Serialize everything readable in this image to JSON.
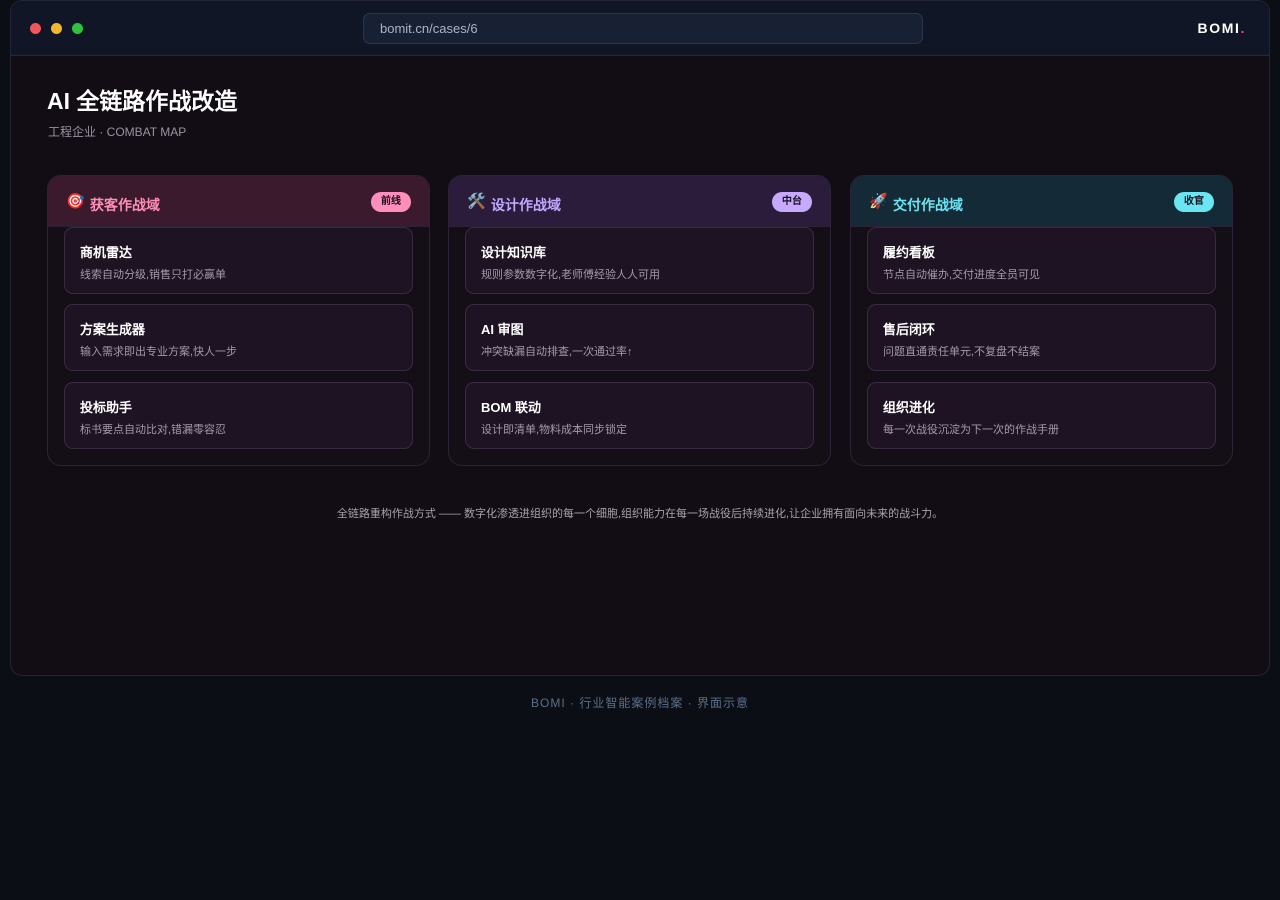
{
  "browser": {
    "url": "bomit.cn/cases/6",
    "brand": "BOMI",
    "brand_accent": "."
  },
  "page": {
    "title": "AI 全链路作战改造",
    "subtitle": "工程企业 · COMBAT MAP"
  },
  "columns": [
    {
      "icon": "🎯",
      "title": "获客作战域",
      "badge": "前线",
      "cards": [
        {
          "title": "商机雷达",
          "desc": "线索自动分级,销售只打必赢单"
        },
        {
          "title": "方案生成器",
          "desc": "输入需求即出专业方案,快人一步"
        },
        {
          "title": "投标助手",
          "desc": "标书要点自动比对,错漏零容忍"
        }
      ]
    },
    {
      "icon": "🛠️",
      "title": "设计作战域",
      "badge": "中台",
      "cards": [
        {
          "title": "设计知识库",
          "desc": "规则参数数字化,老师傅经验人人可用"
        },
        {
          "title": "AI 审图",
          "desc": "冲突缺漏自动排查,一次通过率↑"
        },
        {
          "title": "BOM 联动",
          "desc": "设计即清单,物料成本同步锁定"
        }
      ]
    },
    {
      "icon": "🚀",
      "title": "交付作战域",
      "badge": "收官",
      "cards": [
        {
          "title": "履约看板",
          "desc": "节点自动催办,交付进度全员可见"
        },
        {
          "title": "售后闭环",
          "desc": "问题直通责任单元,不复盘不结案"
        },
        {
          "title": "组织进化",
          "desc": "每一次战役沉淀为下一次的作战手册"
        }
      ]
    }
  ],
  "tagline": "全链路重构作战方式 —— 数字化渗透进组织的每一个细胞,组织能力在每一场战役后持续进化,让企业拥有面向未来的战斗力。",
  "footer": "BOMI · 行业智能案例档案 · 界面示意",
  "colors": {
    "brand_accent": "#ff3d7a",
    "acquisition": "#ff8fb8",
    "design": "#c4a8ff",
    "delivery": "#6ee4f2"
  }
}
